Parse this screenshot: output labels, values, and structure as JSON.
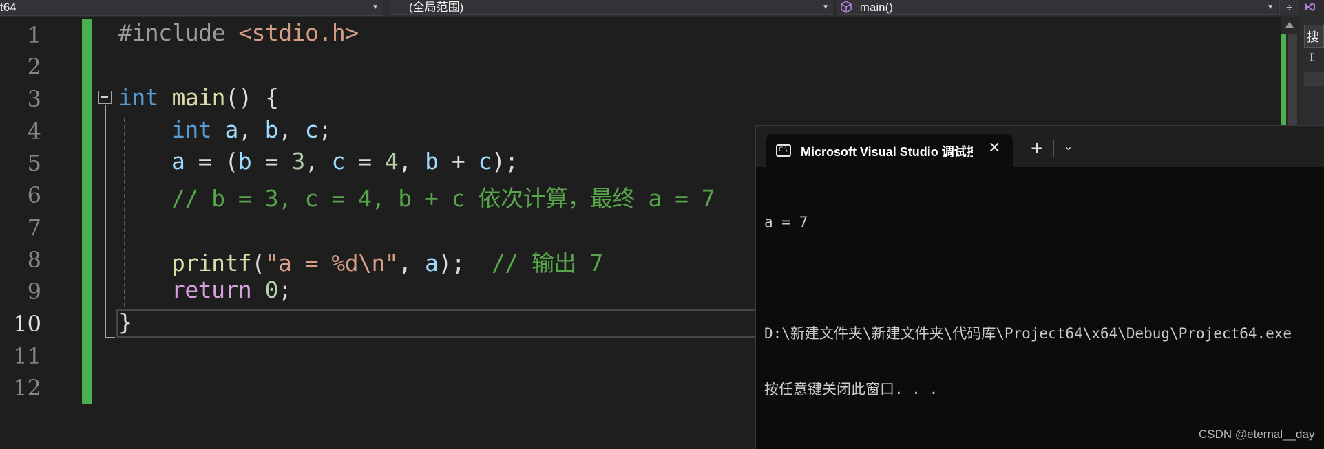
{
  "navbar": {
    "project_combo": "t64",
    "scope_combo": "(全局范围)",
    "member_combo": "main()",
    "split_icon": "split-window-icon"
  },
  "right_panel": {
    "tab_label": "搜",
    "tab2_label": "I"
  },
  "editor": {
    "line_numbers": [
      "1",
      "2",
      "3",
      "4",
      "5",
      "6",
      "7",
      "8",
      "9",
      "10",
      "11",
      "12"
    ],
    "current_line": "10",
    "lines": {
      "l1": {
        "pp": "#include ",
        "inc": "<stdio.h>"
      },
      "l3": {
        "kw": "int",
        "fn": "main",
        "rest": "() {"
      },
      "l4": {
        "kw": "int",
        "v1": "a",
        "v2": "b",
        "v3": "c",
        "sep": ", ",
        "end": ";"
      },
      "l5": {
        "v_a": "a",
        "eq": " = (",
        "v_b": "b",
        "eq2": " = ",
        "n3": "3",
        "c1": ", ",
        "v_c": "c",
        "eq3": " = ",
        "n4": "4",
        "c2": ", ",
        "v_b2": "b",
        "plus": " + ",
        "v_c2": "c",
        "end": ");"
      },
      "l6": {
        "cmt": "// b = 3, c = 4, b + c 依次计算，最终 a = 7"
      },
      "l8": {
        "fn": "printf",
        "open": "(",
        "str": "\"a = %d\\n\"",
        "comma": ", ",
        "v_a": "a",
        "close": ");  ",
        "cmt": "// 输出 7"
      },
      "l9": {
        "kw": "return",
        "num": "0",
        "end": ";"
      },
      "l10": {
        "brace": "}"
      }
    }
  },
  "terminal": {
    "tab_title": "Microsoft Visual Studio 调试控制台",
    "tab_icon": "console-icon",
    "close_glyph": "✕",
    "add_glyph": "+",
    "dropdown_glyph": "⌄",
    "output": [
      "a = 7",
      "",
      "D:\\新建文件夹\\新建文件夹\\代码库\\Project64\\x64\\Debug\\Project64.exe",
      "按任意键关闭此窗口. . ."
    ]
  },
  "watermark": "CSDN @eternal__day",
  "colors": {
    "keyword": "#569cd6",
    "function": "#dcdcaa",
    "variable": "#9cdcfe",
    "number": "#b5cea8",
    "string": "#d69d85",
    "comment": "#57a64a",
    "change_bar": "#4caf50"
  }
}
